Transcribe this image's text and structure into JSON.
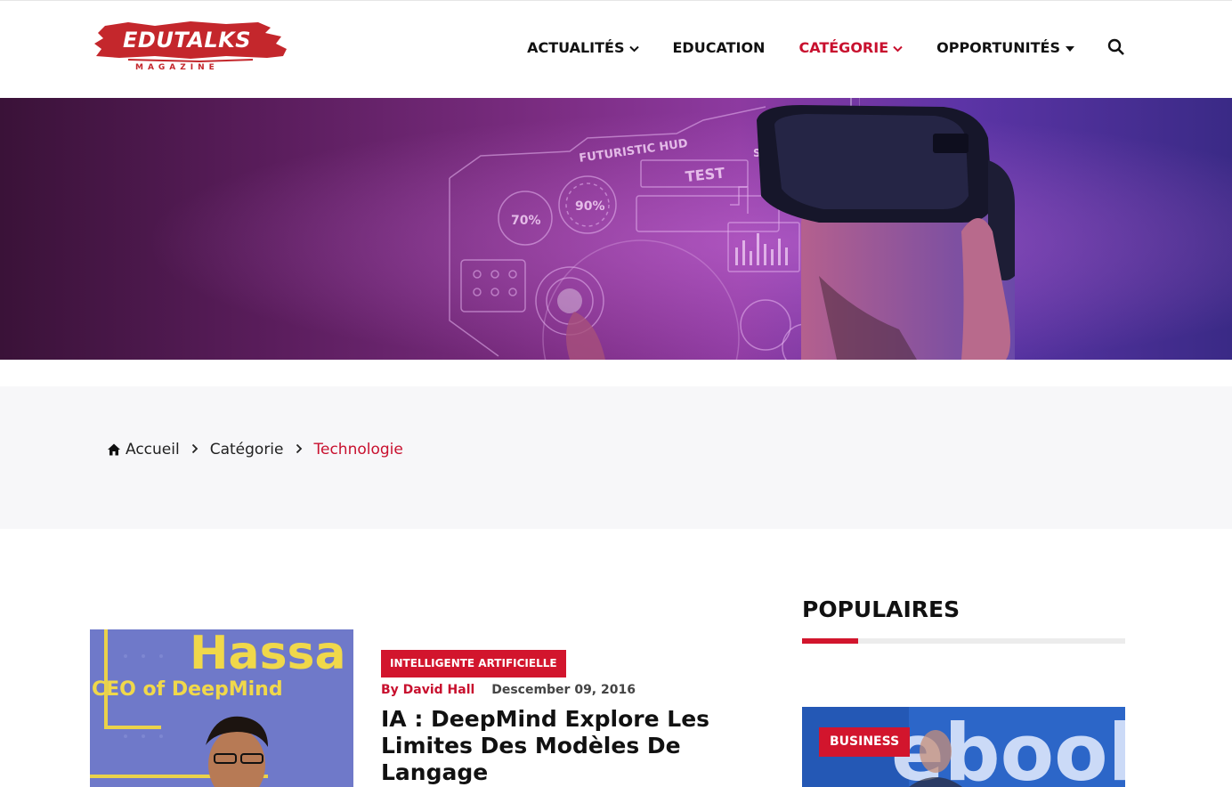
{
  "header": {
    "logo_main": "EDUTALKS",
    "logo_sub": "MAGAZINE",
    "nav": [
      {
        "label": "ACTUALITÉS",
        "active": false,
        "icon": "chevron-down-icon"
      },
      {
        "label": "EDUCATION",
        "active": false,
        "icon": ""
      },
      {
        "label": "CATÉGORIE",
        "active": true,
        "icon": "chevron-down-icon"
      },
      {
        "label": "OPPORTUNITÉS",
        "active": false,
        "icon": "caret-down-icon"
      }
    ],
    "search_icon": "search-icon"
  },
  "hero": {
    "hud_title": "FUTURISTIC HUD",
    "hud_test": "TEST",
    "hud_code": "S-01",
    "gauge_1": "70%",
    "gauge_2": "90%"
  },
  "breadcrumb": {
    "home": "Accueil",
    "category": "Catégorie",
    "current": "Technologie"
  },
  "article": {
    "badge": "INTELLIGENTE ARTIFICIELLE",
    "author": "By David Hall",
    "date": "Descember 09, 2016",
    "title": "IA : DeepMind Explore Les Limites Des Modèles De Langage",
    "thumb_text_1": "Hassa",
    "thumb_text_2": "CEO of DeepMind"
  },
  "sidebar": {
    "title": "POPULAIRES",
    "card_badge": "BUSINESS",
    "card_bg_text": "ebool"
  },
  "colors": {
    "accent": "#c8102e",
    "badge": "#d2152d",
    "band": "#f7f7f9"
  }
}
